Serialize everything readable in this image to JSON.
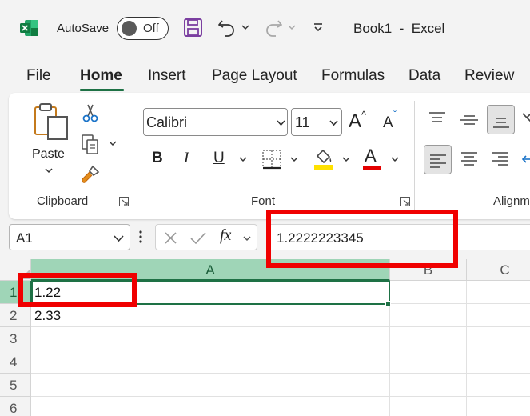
{
  "title_bar": {
    "autosave_label": "AutoSave",
    "autosave_state": "Off",
    "window_title": "Book1  -  Excel"
  },
  "tabs": [
    "File",
    "Home",
    "Insert",
    "Page Layout",
    "Formulas",
    "Data",
    "Review"
  ],
  "ribbon": {
    "clipboard": {
      "paste_label": "Paste",
      "group_label": "Clipboard"
    },
    "font": {
      "font_name": "Calibri",
      "font_size": "11",
      "bold": "B",
      "italic": "I",
      "underline": "U",
      "grow_font": "A",
      "shrink_font": "A",
      "font_color": "A",
      "group_label": "Font"
    },
    "alignment": {
      "group_label": "Alignm"
    }
  },
  "formula_bar": {
    "name_box": "A1",
    "fx": "fx",
    "value": "1.2222223345"
  },
  "grid": {
    "columns": [
      "A",
      "B",
      "C"
    ],
    "rows": [
      "1",
      "2",
      "3",
      "4",
      "5",
      "6"
    ],
    "cells": {
      "A1": "1.22",
      "A2": "2.33"
    }
  },
  "colors": {
    "excel_green": "#1e7145",
    "selection_header": "#9fd5b7",
    "annotation_red": "#f00000",
    "fill_color_bar": "#ffe100",
    "font_color_bar": "#e40000"
  }
}
